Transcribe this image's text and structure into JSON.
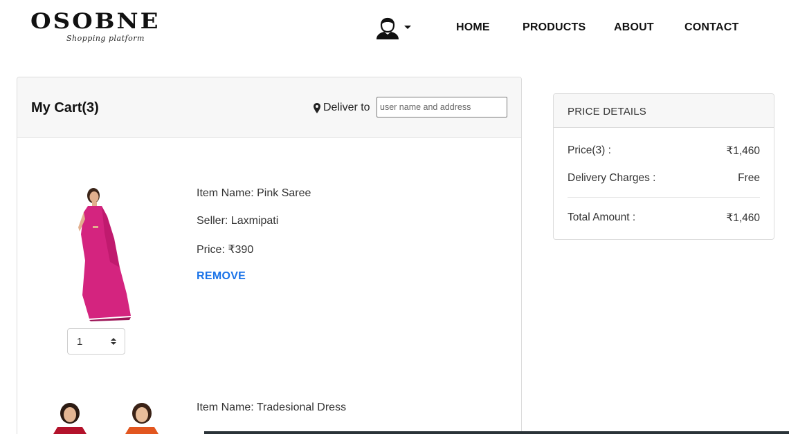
{
  "brand": {
    "name": "OSOBNE",
    "tagline": "Shopping platform"
  },
  "header": {
    "user_icon": "user-avatar-icon",
    "caret_icon": "caret-down-icon",
    "nav": [
      "HOME",
      "PRODUCTS",
      "ABOUT",
      "CONTACT"
    ]
  },
  "cart": {
    "title": "My Cart(3)",
    "deliver_label": "Deliver to",
    "deliver_icon": "map-marker-icon",
    "deliver_placeholder": "user name and address",
    "items": [
      {
        "name": "Item Name: Pink Saree",
        "seller": "Seller: Laxmipati",
        "price": "Price: ₹390",
        "remove": "REMOVE",
        "quantity": "1",
        "image_color": "#d4247f"
      },
      {
        "name": "Item Name: Tradesional Dress"
      }
    ]
  },
  "price_details": {
    "title": "PRICE DETAILS",
    "rows": [
      {
        "label": "Price(3) :",
        "value": "₹1,460"
      },
      {
        "label": "Delivery Charges :",
        "value": "Free"
      },
      {
        "label": "Total Amount :",
        "value": "₹1,460"
      }
    ]
  },
  "colors": {
    "link": "#1a73e8",
    "header_bg": "#f7f7f7",
    "border": "#dcdcdc"
  }
}
